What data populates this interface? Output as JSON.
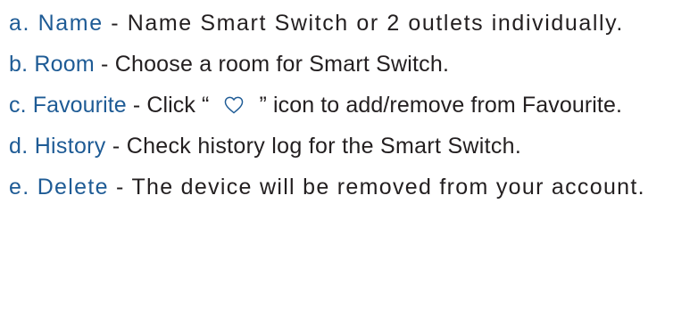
{
  "items": [
    {
      "letter": "a.",
      "term": "Name",
      "description": " - Name Smart Switch or 2 outlets individually."
    },
    {
      "letter": "b.",
      "term": "Room",
      "description": " - Choose a room for Smart Switch."
    },
    {
      "letter": "c.",
      "term": "Favourite",
      "description_before": " - Click “",
      "icon": "heart-outline-icon",
      "description_after": "” icon to add/remove from Favourite."
    },
    {
      "letter": "d.",
      "term": "History",
      "description": " - Check history log for the Smart Switch."
    },
    {
      "letter": "e.",
      "term": "Delete",
      "description": " - The device will be removed from your account."
    }
  ],
  "colors": {
    "term": "#1e5b95",
    "text": "#231f20"
  }
}
